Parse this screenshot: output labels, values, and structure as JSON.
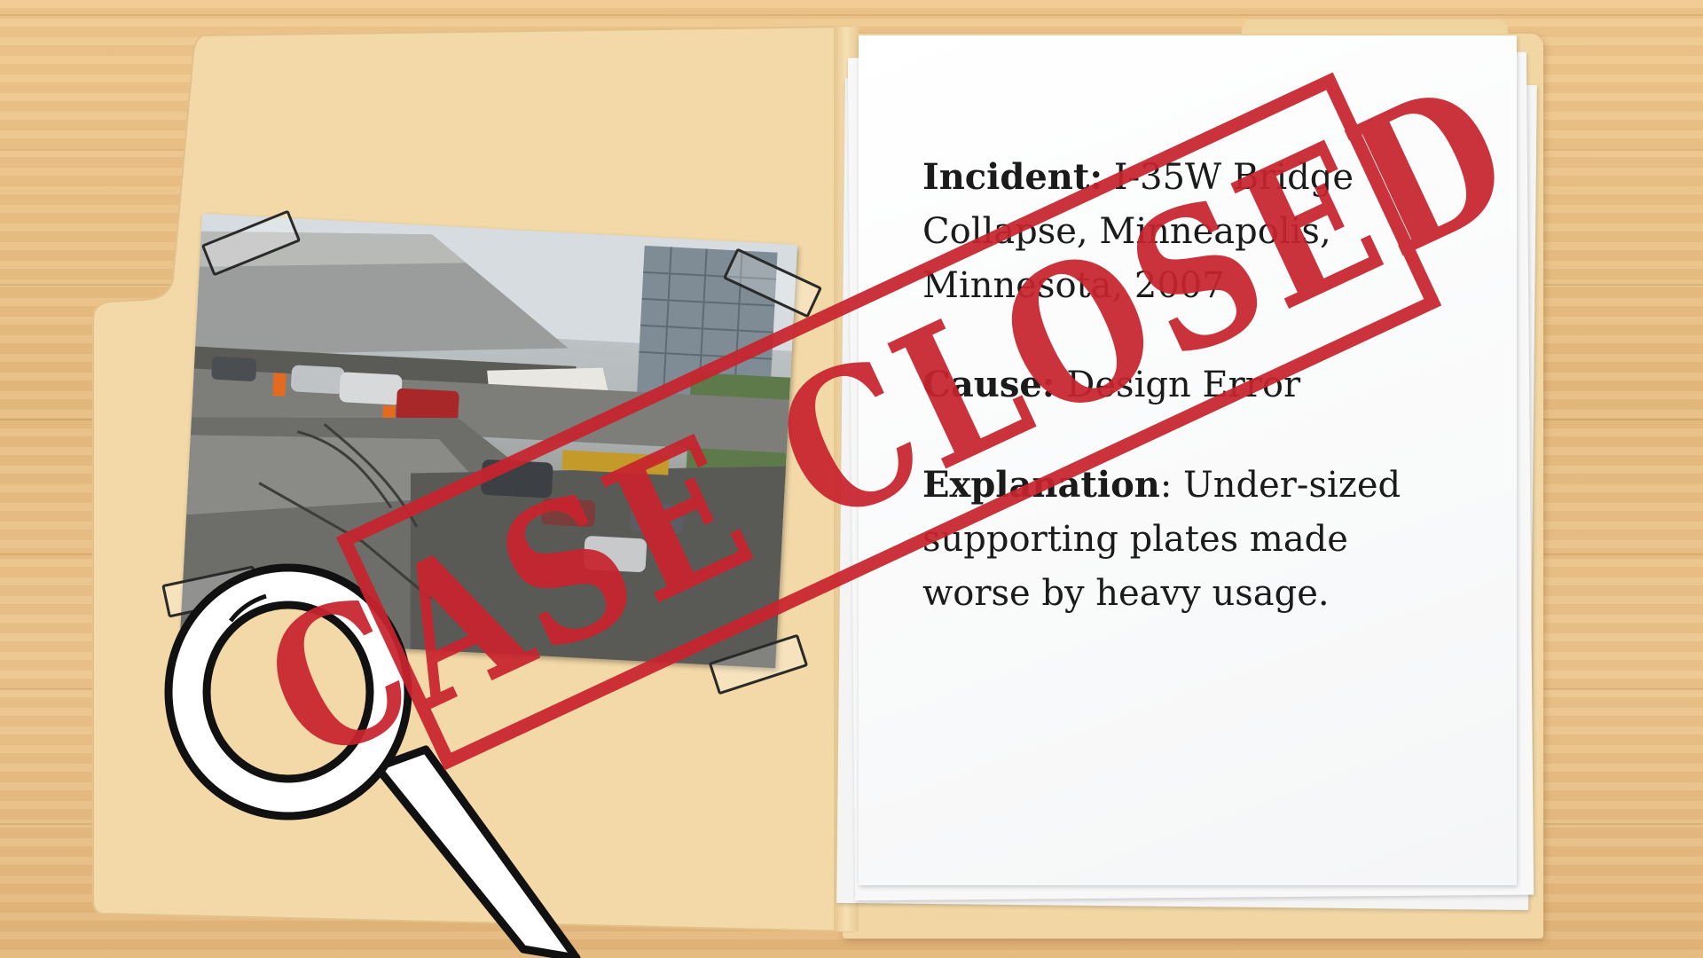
{
  "case_file": {
    "incident": {
      "label": "Incident:",
      "value": " I-35W Bridge Collapse, Minneapolis, Minnesota, 2007"
    },
    "cause": {
      "label": "Cause:",
      "value": " Design Error"
    },
    "explanation": {
      "label": "Explanation",
      "value": ": Under-sized supporting plates made worse by heavy usage."
    }
  },
  "stamp": {
    "text": "CASE CLOSED",
    "color": "#c8242e"
  },
  "icons": {
    "magnifier": "magnifying-glass-icon"
  }
}
